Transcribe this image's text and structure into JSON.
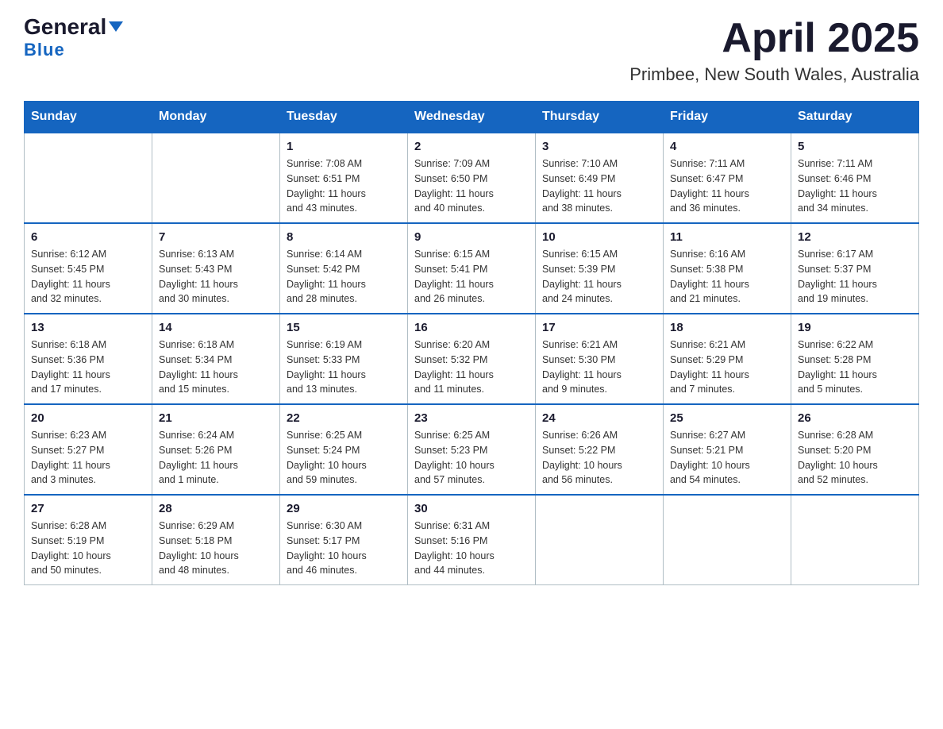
{
  "logo": {
    "general": "General",
    "blue": "Blue"
  },
  "title": "April 2025",
  "subtitle": "Primbee, New South Wales, Australia",
  "weekdays": [
    "Sunday",
    "Monday",
    "Tuesday",
    "Wednesday",
    "Thursday",
    "Friday",
    "Saturday"
  ],
  "weeks": [
    [
      {
        "day": "",
        "info": ""
      },
      {
        "day": "",
        "info": ""
      },
      {
        "day": "1",
        "info": "Sunrise: 7:08 AM\nSunset: 6:51 PM\nDaylight: 11 hours\nand 43 minutes."
      },
      {
        "day": "2",
        "info": "Sunrise: 7:09 AM\nSunset: 6:50 PM\nDaylight: 11 hours\nand 40 minutes."
      },
      {
        "day": "3",
        "info": "Sunrise: 7:10 AM\nSunset: 6:49 PM\nDaylight: 11 hours\nand 38 minutes."
      },
      {
        "day": "4",
        "info": "Sunrise: 7:11 AM\nSunset: 6:47 PM\nDaylight: 11 hours\nand 36 minutes."
      },
      {
        "day": "5",
        "info": "Sunrise: 7:11 AM\nSunset: 6:46 PM\nDaylight: 11 hours\nand 34 minutes."
      }
    ],
    [
      {
        "day": "6",
        "info": "Sunrise: 6:12 AM\nSunset: 5:45 PM\nDaylight: 11 hours\nand 32 minutes."
      },
      {
        "day": "7",
        "info": "Sunrise: 6:13 AM\nSunset: 5:43 PM\nDaylight: 11 hours\nand 30 minutes."
      },
      {
        "day": "8",
        "info": "Sunrise: 6:14 AM\nSunset: 5:42 PM\nDaylight: 11 hours\nand 28 minutes."
      },
      {
        "day": "9",
        "info": "Sunrise: 6:15 AM\nSunset: 5:41 PM\nDaylight: 11 hours\nand 26 minutes."
      },
      {
        "day": "10",
        "info": "Sunrise: 6:15 AM\nSunset: 5:39 PM\nDaylight: 11 hours\nand 24 minutes."
      },
      {
        "day": "11",
        "info": "Sunrise: 6:16 AM\nSunset: 5:38 PM\nDaylight: 11 hours\nand 21 minutes."
      },
      {
        "day": "12",
        "info": "Sunrise: 6:17 AM\nSunset: 5:37 PM\nDaylight: 11 hours\nand 19 minutes."
      }
    ],
    [
      {
        "day": "13",
        "info": "Sunrise: 6:18 AM\nSunset: 5:36 PM\nDaylight: 11 hours\nand 17 minutes."
      },
      {
        "day": "14",
        "info": "Sunrise: 6:18 AM\nSunset: 5:34 PM\nDaylight: 11 hours\nand 15 minutes."
      },
      {
        "day": "15",
        "info": "Sunrise: 6:19 AM\nSunset: 5:33 PM\nDaylight: 11 hours\nand 13 minutes."
      },
      {
        "day": "16",
        "info": "Sunrise: 6:20 AM\nSunset: 5:32 PM\nDaylight: 11 hours\nand 11 minutes."
      },
      {
        "day": "17",
        "info": "Sunrise: 6:21 AM\nSunset: 5:30 PM\nDaylight: 11 hours\nand 9 minutes."
      },
      {
        "day": "18",
        "info": "Sunrise: 6:21 AM\nSunset: 5:29 PM\nDaylight: 11 hours\nand 7 minutes."
      },
      {
        "day": "19",
        "info": "Sunrise: 6:22 AM\nSunset: 5:28 PM\nDaylight: 11 hours\nand 5 minutes."
      }
    ],
    [
      {
        "day": "20",
        "info": "Sunrise: 6:23 AM\nSunset: 5:27 PM\nDaylight: 11 hours\nand 3 minutes."
      },
      {
        "day": "21",
        "info": "Sunrise: 6:24 AM\nSunset: 5:26 PM\nDaylight: 11 hours\nand 1 minute."
      },
      {
        "day": "22",
        "info": "Sunrise: 6:25 AM\nSunset: 5:24 PM\nDaylight: 10 hours\nand 59 minutes."
      },
      {
        "day": "23",
        "info": "Sunrise: 6:25 AM\nSunset: 5:23 PM\nDaylight: 10 hours\nand 57 minutes."
      },
      {
        "day": "24",
        "info": "Sunrise: 6:26 AM\nSunset: 5:22 PM\nDaylight: 10 hours\nand 56 minutes."
      },
      {
        "day": "25",
        "info": "Sunrise: 6:27 AM\nSunset: 5:21 PM\nDaylight: 10 hours\nand 54 minutes."
      },
      {
        "day": "26",
        "info": "Sunrise: 6:28 AM\nSunset: 5:20 PM\nDaylight: 10 hours\nand 52 minutes."
      }
    ],
    [
      {
        "day": "27",
        "info": "Sunrise: 6:28 AM\nSunset: 5:19 PM\nDaylight: 10 hours\nand 50 minutes."
      },
      {
        "day": "28",
        "info": "Sunrise: 6:29 AM\nSunset: 5:18 PM\nDaylight: 10 hours\nand 48 minutes."
      },
      {
        "day": "29",
        "info": "Sunrise: 6:30 AM\nSunset: 5:17 PM\nDaylight: 10 hours\nand 46 minutes."
      },
      {
        "day": "30",
        "info": "Sunrise: 6:31 AM\nSunset: 5:16 PM\nDaylight: 10 hours\nand 44 minutes."
      },
      {
        "day": "",
        "info": ""
      },
      {
        "day": "",
        "info": ""
      },
      {
        "day": "",
        "info": ""
      }
    ]
  ]
}
